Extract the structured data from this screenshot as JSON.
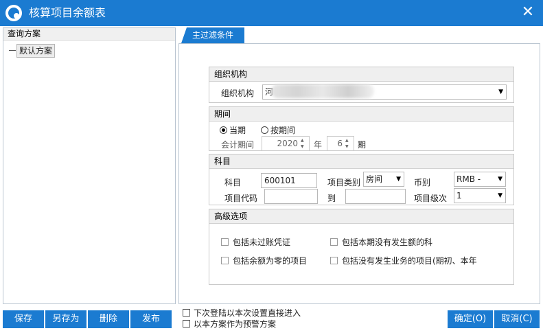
{
  "window": {
    "title": "核算项目余额表",
    "close_glyph": "✕"
  },
  "left_panel": {
    "header": "查询方案",
    "tree_items": [
      {
        "label": "默认方案"
      }
    ]
  },
  "tab": {
    "label": "主过滤条件"
  },
  "org_group": {
    "title": "组织机构",
    "field_label": "组织机构",
    "field_value": "河",
    "dropdown_glyph": "▼"
  },
  "period_group": {
    "title": "期间",
    "radio_current": "当期",
    "radio_by_period": "按期间",
    "selected": "当期",
    "label": "会计期间",
    "year": "2020",
    "year_unit": "年",
    "period": "6",
    "period_unit": "期",
    "spin_up": "▲",
    "spin_down": "▼"
  },
  "subject_group": {
    "title": "科目",
    "subject_label": "科目",
    "subject_value": "600101",
    "item_type_label": "项目类别",
    "item_type_value": "房间",
    "currency_label": "币别",
    "currency_value": "RMB -",
    "item_code_label": "项目代码",
    "item_code_value": "",
    "to_label": "到",
    "to_value": "",
    "item_level_label": "项目级次",
    "item_level_value": "1",
    "dropdown_glyph": "▼"
  },
  "advanced_group": {
    "title": "高级选项",
    "options": [
      {
        "label": "包括未过账凭证",
        "checked": false
      },
      {
        "label": "包括本期没有发生额的科",
        "checked": false
      },
      {
        "label": "包括余额为零的项目",
        "checked": false
      },
      {
        "label": "包括没有发生业务的项目(期初、本年",
        "checked": false
      }
    ]
  },
  "bottom": {
    "save": "保存",
    "save_as": "另存为",
    "delete": "删除",
    "publish": "发布",
    "check_direct_enter": "下次登陆以本次设置直接进入",
    "check_warning_scheme": "以本方案作为预警方案",
    "ok": "确定(O)",
    "cancel": "取消(C)"
  },
  "colors": {
    "accent": "#1b7bd1",
    "group_header_bg": "#efefef",
    "border": "#c8c8c8"
  },
  "icons": {
    "app_logo": "app-logo-icon",
    "close": "close-icon",
    "dropdown": "chevron-down-icon",
    "spin": "spin-arrows-icon"
  }
}
